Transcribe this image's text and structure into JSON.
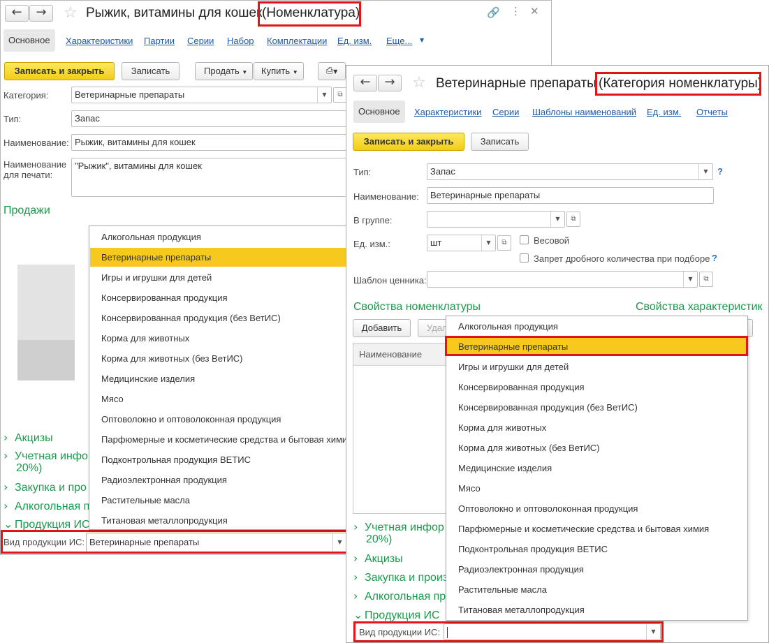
{
  "win1": {
    "title": "Рыжик, витамины для кошек",
    "title_hint": "(Номенклатура)",
    "tabs": [
      "Основное",
      "Характеристики",
      "Партии",
      "Серии",
      "Набор",
      "Комплектации",
      "Ед. изм.",
      "Еще..."
    ],
    "toolbar": {
      "save_close": "Записать и закрыть",
      "save": "Записать",
      "sell": "Продать",
      "buy": "Купить"
    },
    "fields": {
      "category_label": "Категория:",
      "category_value": "Ветеринарные препараты",
      "type_label": "Тип:",
      "type_value": "Запас",
      "name_label": "Наименование:",
      "name_value": "Рыжик, витамины для кошек",
      "print_label_1": "Наименование",
      "print_label_2": "для печати:",
      "print_value": "\"Рыжик\", витамины для кошек"
    },
    "sales_section": "Продажи",
    "collapsible": [
      "Акцизы",
      "Учетная инфо",
      "20%)",
      "Закупка и про",
      "Алкогольная п",
      "Продукция ИС"
    ],
    "product_type_label": "Вид продукции ИС:",
    "product_type_value": "Ветеринарные препараты",
    "dropdown": [
      "Алкогольная продукция",
      "Ветеринарные препараты",
      "Игры и игрушки для детей",
      "Консервированная продукция",
      "Консервированная продукция (без ВетИС)",
      "Корма для животных",
      "Корма для животных (без ВетИС)",
      "Медицинские изделия",
      "Мясо",
      "Оптоволокно и оптоволоконная продукция",
      "Парфюмерные и косметические средства и бытовая химия",
      "Подконтрольная продукция ВЕТИС",
      "Радиоэлектронная продукция",
      "Растительные масла",
      "Титановая металлопродукция"
    ]
  },
  "win2": {
    "title": "Ветеринарные препараты",
    "title_hint": "(Категория номенклатуры)",
    "tabs": [
      "Основное",
      "Характеристики",
      "Серии",
      "Шаблоны наименований",
      "Ед. изм.",
      "Отчеты"
    ],
    "toolbar": {
      "save_close": "Записать и закрыть",
      "save": "Записать"
    },
    "fields": {
      "type_label": "Тип:",
      "type_value": "Запас",
      "name_label": "Наименование:",
      "name_value": "Ветеринарные препараты",
      "group_label": "В группе:",
      "group_value": "",
      "unit_label": "Ед. изм.:",
      "unit_value": "шт",
      "weight_label": "Весовой",
      "fraction_label": "Запрет дробного количества при подборе",
      "price_tag_label": "Шаблон ценника:",
      "price_tag_value": ""
    },
    "props_nom": "Свойства номенклатуры",
    "props_char": "Свойства характеристик",
    "add_btn": "Добавить",
    "del_btn_partial": "Удал",
    "table_header": "Наименование",
    "collapsible": [
      "Учетная инфор",
      "20%)",
      "Акцизы",
      "Закупка и произ",
      "Алкогольная пр",
      "Продукция ИС"
    ],
    "product_type_label": "Вид продукции ИС:",
    "product_type_value": "",
    "dropdown": [
      "Алкогольная продукция",
      "Ветеринарные препараты",
      "Игры и игрушки для детей",
      "Консервированная продукция",
      "Консервированная продукция (без ВетИС)",
      "Корма для животных",
      "Корма для животных (без ВетИС)",
      "Медицинские изделия",
      "Мясо",
      "Оптоволокно и оптоволоконная продукция",
      "Парфюмерные и косметические средства и бытовая химия",
      "Подконтрольная продукция ВЕТИС",
      "Радиоэлектронная продукция",
      "Растительные масла",
      "Титановая металлопродукция"
    ]
  },
  "colors": {
    "accent_yellow": "#f7c81e",
    "highlight_red": "#e0151b",
    "link_blue": "#1e5aa8",
    "section_green": "#1a9a4b"
  }
}
